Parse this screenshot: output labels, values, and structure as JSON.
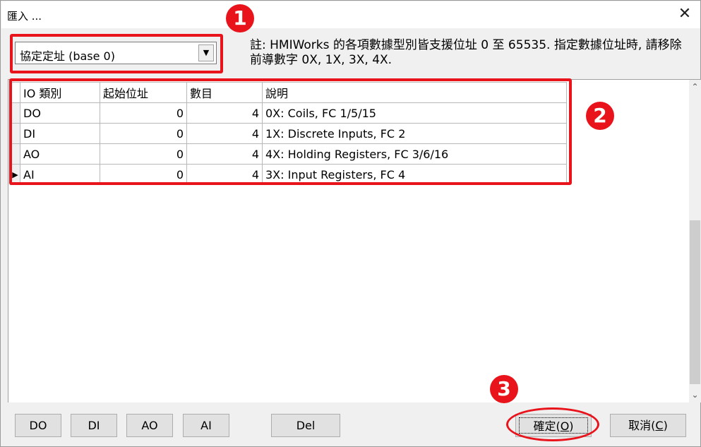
{
  "window": {
    "title": "匯入 ...",
    "close_glyph": "✕"
  },
  "address_mode": {
    "selected": "協定定址 (base 0)",
    "arrow_glyph": "▼"
  },
  "note": "註: HMIWorks 的各項數據型別皆支援位址 0 至 65535. 指定數據位址時, 請移除前導數字 0X, 1X, 3X, 4X.",
  "grid": {
    "headers": {
      "type": "IO 類別",
      "start": "起始位址",
      "count": "數目",
      "desc": "說明"
    },
    "rows": [
      {
        "type": "DO",
        "start": "0",
        "count": "4",
        "desc": "0X: Coils, FC 1/5/15",
        "current": false
      },
      {
        "type": "DI",
        "start": "0",
        "count": "4",
        "desc": "1X: Discrete Inputs, FC 2",
        "current": false
      },
      {
        "type": "AO",
        "start": "0",
        "count": "4",
        "desc": "4X: Holding Registers, FC 3/6/16",
        "current": false
      },
      {
        "type": "AI",
        "start": "0",
        "count": "4",
        "desc": "3X: Input Registers, FC 4",
        "current": true
      }
    ],
    "current_row_glyph": "▶",
    "scroll_up_glyph": "⌃",
    "scroll_down_glyph": "⌄"
  },
  "buttons": {
    "do": "DO",
    "di": "DI",
    "ao": "AO",
    "ai": "AI",
    "del": "Del",
    "ok": "確定",
    "ok_hotkey": "O",
    "cancel": "取消",
    "cancel_hotkey": "C"
  },
  "annotations": {
    "marker1": "1",
    "marker2": "2",
    "marker3": "3",
    "color": "#e8131b"
  }
}
